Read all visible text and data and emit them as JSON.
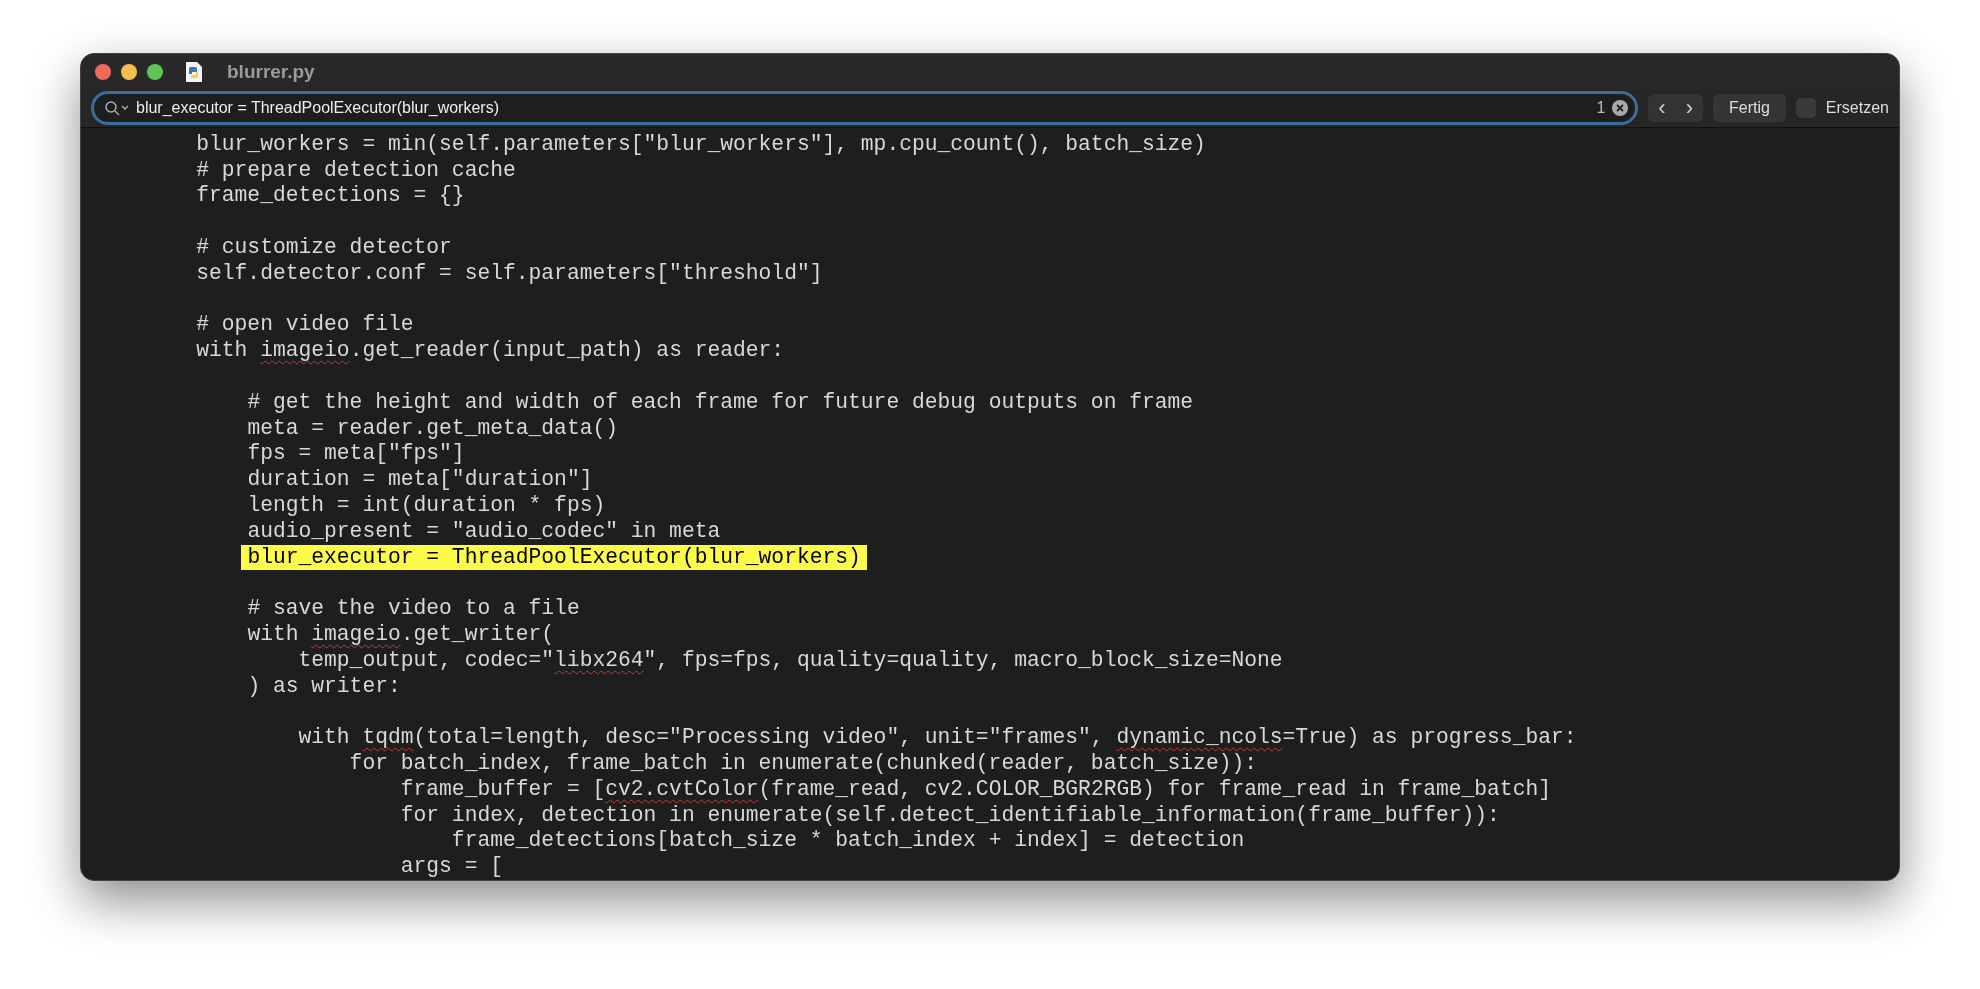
{
  "window": {
    "title": "blurrer.py"
  },
  "find_bar": {
    "query": "blur_executor = ThreadPoolExecutor(blur_workers)",
    "match_count": "1",
    "previous": "‹",
    "next": "›",
    "done_button": "Fertig",
    "replace": {
      "label": "Ersetzen",
      "checked": false
    }
  },
  "code_lines": [
    {
      "kind": "code",
      "highlighted": false,
      "segments": [
        {
          "text": "        blur_workers = min(self.parameters[\"blur_workers\"], mp.cpu_count(), batch_size)",
          "misspelled": false
        }
      ]
    },
    {
      "kind": "code",
      "highlighted": false,
      "segments": [
        {
          "text": "        # prepare detection cache",
          "misspelled": false
        }
      ]
    },
    {
      "kind": "code",
      "highlighted": false,
      "segments": [
        {
          "text": "        frame_detections = {}",
          "misspelled": false
        }
      ]
    },
    {
      "kind": "blank"
    },
    {
      "kind": "code",
      "highlighted": false,
      "segments": [
        {
          "text": "        # customize detector",
          "misspelled": false
        }
      ]
    },
    {
      "kind": "code",
      "highlighted": false,
      "segments": [
        {
          "text": "        self.detector.conf = self.parameters[\"threshold\"]",
          "misspelled": false
        }
      ]
    },
    {
      "kind": "blank"
    },
    {
      "kind": "code",
      "highlighted": false,
      "segments": [
        {
          "text": "        # open video file",
          "misspelled": false
        }
      ]
    },
    {
      "kind": "code",
      "highlighted": false,
      "segments": [
        {
          "text": "        with ",
          "misspelled": false
        },
        {
          "text": "imageio",
          "misspelled": true
        },
        {
          "text": ".get_reader(input_path) as reader:",
          "misspelled": false
        }
      ]
    },
    {
      "kind": "blank"
    },
    {
      "kind": "code",
      "highlighted": false,
      "segments": [
        {
          "text": "            # get the height and width of each frame for future debug outputs on frame",
          "misspelled": false
        }
      ]
    },
    {
      "kind": "code",
      "highlighted": false,
      "segments": [
        {
          "text": "            meta = reader.get_meta_data()",
          "misspelled": false
        }
      ]
    },
    {
      "kind": "code",
      "highlighted": false,
      "segments": [
        {
          "text": "            fps = meta[\"fps\"]",
          "misspelled": false
        }
      ]
    },
    {
      "kind": "code",
      "highlighted": false,
      "segments": [
        {
          "text": "            duration = meta[\"duration\"]",
          "misspelled": false
        }
      ]
    },
    {
      "kind": "code",
      "highlighted": false,
      "segments": [
        {
          "text": "            length = int(duration * fps)",
          "misspelled": false
        }
      ]
    },
    {
      "kind": "code",
      "highlighted": false,
      "segments": [
        {
          "text": "            audio_present = \"audio_codec\" in meta",
          "misspelled": false
        }
      ]
    },
    {
      "kind": "code",
      "highlighted": true,
      "segments": [
        {
          "text": "            blur_executor = ThreadPoolExecutor(blur_workers)",
          "misspelled": false
        }
      ]
    },
    {
      "kind": "blank"
    },
    {
      "kind": "code",
      "highlighted": false,
      "segments": [
        {
          "text": "            # save the video to a file",
          "misspelled": false
        }
      ]
    },
    {
      "kind": "code",
      "highlighted": false,
      "segments": [
        {
          "text": "            with ",
          "misspelled": false
        },
        {
          "text": "imageio",
          "misspelled": true
        },
        {
          "text": ".get_writer(",
          "misspelled": false
        }
      ]
    },
    {
      "kind": "code",
      "highlighted": false,
      "segments": [
        {
          "text": "                temp_output, codec=\"",
          "misspelled": false
        },
        {
          "text": "libx264",
          "misspelled": true
        },
        {
          "text": "\", fps=fps, quality=quality, macro_block_size=None",
          "misspelled": false
        }
      ]
    },
    {
      "kind": "code",
      "highlighted": false,
      "segments": [
        {
          "text": "            ) as writer:",
          "misspelled": false
        }
      ]
    },
    {
      "kind": "blank"
    },
    {
      "kind": "code",
      "highlighted": false,
      "segments": [
        {
          "text": "                with ",
          "misspelled": false
        },
        {
          "text": "tqdm",
          "misspelled": true
        },
        {
          "text": "(total=length, desc=\"Processing video\", unit=\"frames\", ",
          "misspelled": false
        },
        {
          "text": "dynamic_ncols",
          "misspelled": true
        },
        {
          "text": "=True) as progress_bar:",
          "misspelled": false
        }
      ]
    },
    {
      "kind": "code",
      "highlighted": false,
      "segments": [
        {
          "text": "                    for batch_index, frame_batch in enumerate(chunked(reader, batch_size)):",
          "misspelled": false
        }
      ]
    },
    {
      "kind": "code",
      "highlighted": false,
      "segments": [
        {
          "text": "                        frame_buffer = [",
          "misspelled": false
        },
        {
          "text": "cv2.cvtColor",
          "misspelled": true
        },
        {
          "text": "(frame_read, cv2.COLOR_BGR2RGB) for frame_read in frame_batch]",
          "misspelled": false
        }
      ]
    },
    {
      "kind": "code",
      "highlighted": false,
      "segments": [
        {
          "text": "                        for index, detection in enumerate(self.detect_identifiable_information(frame_buffer)):",
          "misspelled": false
        }
      ]
    },
    {
      "kind": "code",
      "highlighted": false,
      "segments": [
        {
          "text": "                            frame_detections[batch_size * batch_index + index] = detection",
          "misspelled": false
        }
      ]
    },
    {
      "kind": "code",
      "highlighted": false,
      "segments": [
        {
          "text": "                        args = [",
          "misspelled": false
        }
      ]
    }
  ]
}
